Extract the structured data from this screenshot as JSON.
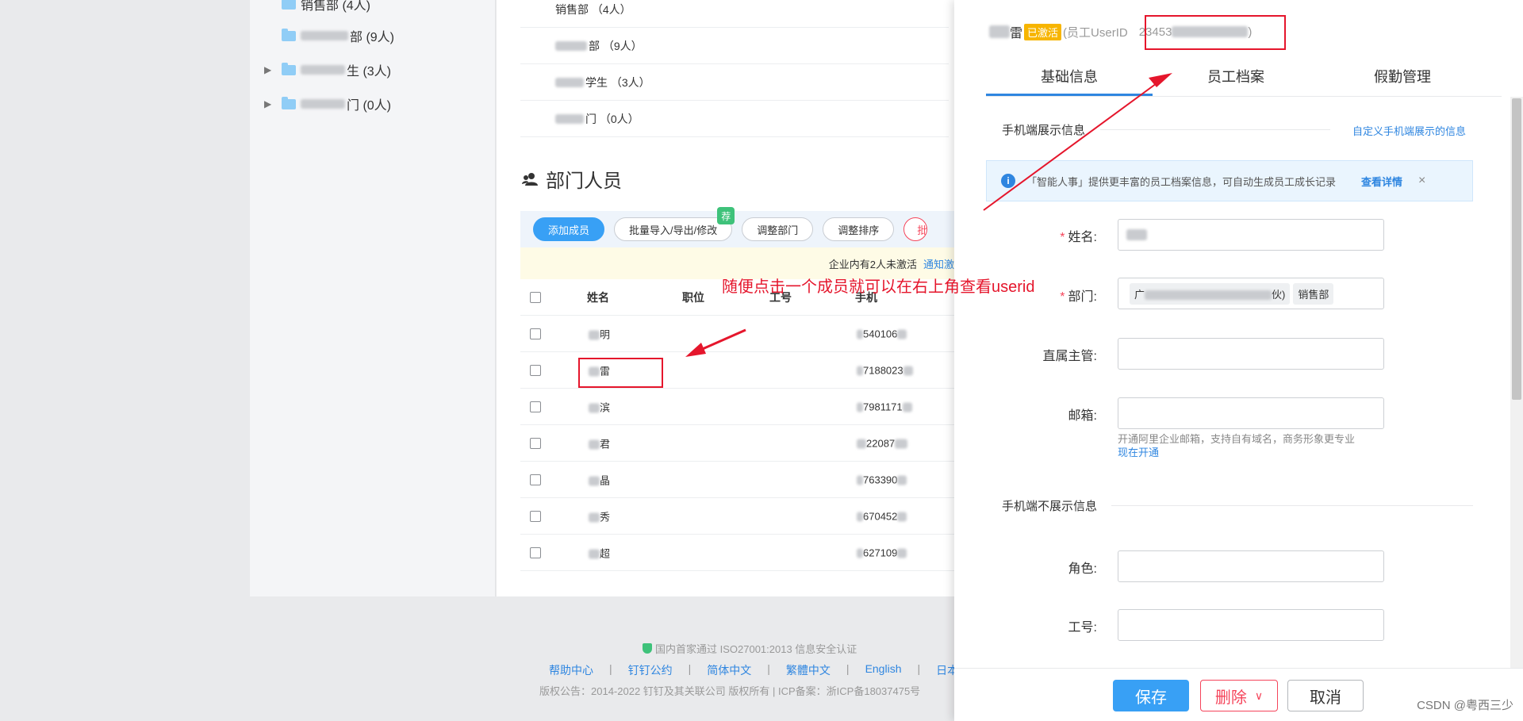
{
  "tree": {
    "items": [
      {
        "label": "销售部 (4人)",
        "expandable": false
      },
      {
        "label": "部 (9人)",
        "expandable": false
      },
      {
        "label": "生 (3人)",
        "expandable": true
      },
      {
        "label": "门 (0人)",
        "expandable": true
      }
    ]
  },
  "sub_departments": [
    {
      "label": "销售部 （4人）"
    },
    {
      "label": "部 （9人）"
    },
    {
      "label": "学生 （3人）"
    },
    {
      "label": "门 （0人）"
    }
  ],
  "members_section": {
    "title": "部门人员",
    "toolbar": {
      "add": "添加成员",
      "import_export": "批量导入/导出/修改",
      "badge": "荐",
      "adjust_dept": "调整部门",
      "adjust_order": "调整排序",
      "batch_partial": "批"
    },
    "notice": {
      "text": "企业内有2人未激活",
      "link": "通知激活"
    },
    "columns": [
      "姓名",
      "职位",
      "工号",
      "手机"
    ],
    "rows": [
      {
        "name": "明",
        "phone": "540106"
      },
      {
        "name": "雷",
        "phone": "7188023"
      },
      {
        "name": "滨",
        "phone": "7981171"
      },
      {
        "name": "君",
        "phone": "22087"
      },
      {
        "name": "晶",
        "phone": "763390"
      },
      {
        "name": "秀",
        "phone": "670452"
      },
      {
        "name": "超",
        "phone": "627109"
      }
    ]
  },
  "footer": {
    "cert": "国内首家通过 ISO27001:2013 信息安全认证",
    "links": [
      "帮助中心",
      "钉钉公约",
      "简体中文",
      "繁體中文",
      "English",
      "日本"
    ],
    "copyright": "版权公告：2014-2022 钉钉及其关联公司 版权所有 | ICP备案：浙ICP备18037475号"
  },
  "drawer": {
    "name": "雷",
    "status": "已激活",
    "userid_label": "(员工UserID",
    "userid_value": "23453",
    "userid_close": ")",
    "tabs": [
      "基础信息",
      "员工档案",
      "假勤管理"
    ],
    "active_tab": 0,
    "section_visible": "手机端展示信息",
    "custom_link": "自定义手机端展示的信息",
    "info": {
      "text": "「智能人事」提供更丰富的员工档案信息，可自动生成员工成长记录",
      "view": "查看详情",
      "close": "×"
    },
    "fields": {
      "name": {
        "label": "姓名",
        "required": true,
        "value": ""
      },
      "dept": {
        "label": "部门",
        "required": true,
        "chip1": "广",
        "chip1_suffix": "伙)",
        "chip2": "销售部"
      },
      "manager": {
        "label": "直属主管",
        "value": ""
      },
      "email": {
        "label": "邮箱",
        "value": ""
      },
      "role": {
        "label": "角色",
        "value": ""
      },
      "job_no": {
        "label": "工号",
        "value": ""
      }
    },
    "email_hint": "开通阿里企业邮箱，支持自有域名，商务形象更专业",
    "email_link": "现在开通",
    "section_hidden": "手机端不展示信息",
    "buttons": {
      "save": "保存",
      "delete": "删除",
      "cancel": "取消"
    }
  },
  "annotation": {
    "text": "随便点击一个成员就可以在右上角查看userid",
    "color": "#e5162c"
  },
  "watermark": "CSDN @粤西三少",
  "colors": {
    "accent": "#2f86e0",
    "primary_button": "#38a0f5",
    "danger": "#f5455b",
    "status_tag": "#f7b500"
  }
}
